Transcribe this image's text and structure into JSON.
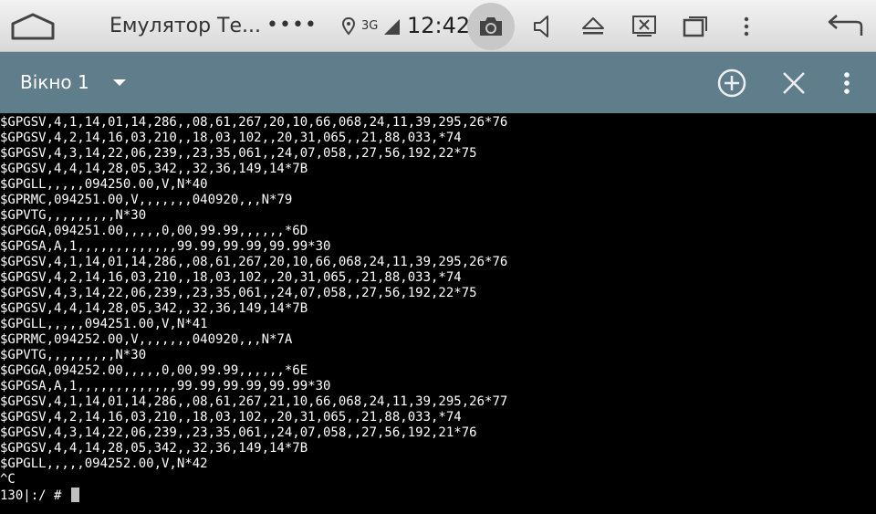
{
  "status_bar": {
    "app_title": "Емулятор Те...",
    "overflow_dots": "••••",
    "network_type": "3G",
    "time": "12:42",
    "icons": [
      "home-icon",
      "location-icon",
      "signal-icon",
      "camera-icon",
      "volume-icon",
      "eject-icon",
      "screen-cast-icon",
      "recent-apps-icon",
      "more-vert-icon",
      "back-icon"
    ]
  },
  "toolbar": {
    "window_title": "Вікно 1",
    "icons": [
      "dropdown-icon",
      "add-window-icon",
      "close-window-icon",
      "more-vert-icon"
    ],
    "color": "#607d8b"
  },
  "terminal": {
    "lines": [
      "$GPGSV,4,1,14,01,14,286,,08,61,267,20,10,66,068,24,11,39,295,26*76",
      "$GPGSV,4,2,14,16,03,210,,18,03,102,,20,31,065,,21,88,033,*74",
      "$GPGSV,4,3,14,22,06,239,,23,35,061,,24,07,058,,27,56,192,22*75",
      "$GPGSV,4,4,14,28,05,342,,32,36,149,14*7B",
      "$GPGLL,,,,,094250.00,V,N*40",
      "$GPRMC,094251.00,V,,,,,,,040920,,,N*79",
      "$GPVTG,,,,,,,,,N*30",
      "$GPGGA,094251.00,,,,,0,00,99.99,,,,,,*6D",
      "$GPGSA,A,1,,,,,,,,,,,,,99.99,99.99,99.99*30",
      "$GPGSV,4,1,14,01,14,286,,08,61,267,20,10,66,068,24,11,39,295,26*76",
      "$GPGSV,4,2,14,16,03,210,,18,03,102,,20,31,065,,21,88,033,*74",
      "$GPGSV,4,3,14,22,06,239,,23,35,061,,24,07,058,,27,56,192,22*75",
      "$GPGSV,4,4,14,28,05,342,,32,36,149,14*7B",
      "$GPGLL,,,,,094251.00,V,N*41",
      "$GPRMC,094252.00,V,,,,,,,040920,,,N*7A",
      "$GPVTG,,,,,,,,,N*30",
      "$GPGGA,094252.00,,,,,0,00,99.99,,,,,,*6E",
      "$GPGSA,A,1,,,,,,,,,,,,,99.99,99.99,99.99*30",
      "$GPGSV,4,1,14,01,14,286,,08,61,267,21,10,66,068,24,11,39,295,26*77",
      "$GPGSV,4,2,14,16,03,210,,18,03,102,,20,31,065,,21,88,033,*74",
      "$GPGSV,4,3,14,22,06,239,,23,35,061,,24,07,058,,27,56,192,21*76",
      "$GPGSV,4,4,14,28,05,342,,32,36,149,14*7B",
      "$GPGLL,,,,,094252.00,V,N*42",
      "^C"
    ],
    "prompt": "130|:/ # ",
    "text_color": "#ffffff",
    "background": "#000000"
  }
}
